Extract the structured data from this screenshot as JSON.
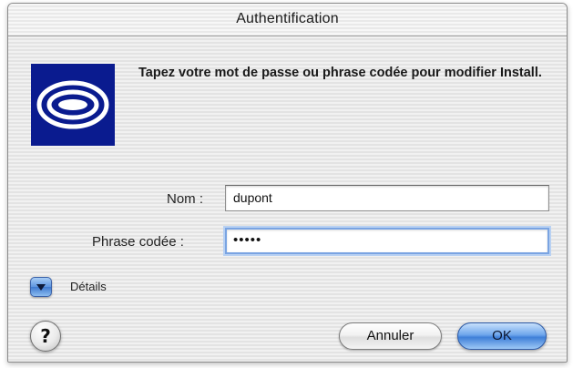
{
  "window": {
    "title": "Authentification"
  },
  "dialog": {
    "message": "Tapez votre mot de passe ou phrase codée pour modifier Install.",
    "app_icon": "install-app-logo"
  },
  "form": {
    "name_label": "Nom :",
    "name_value": "dupont",
    "passphrase_label": "Phrase codée :",
    "passphrase_value": "•••••"
  },
  "details": {
    "label": "Détails",
    "icon": "disclosure-triangle-down-icon"
  },
  "footer": {
    "help_label": "?",
    "cancel_label": "Annuler",
    "ok_label": "OK"
  },
  "colors": {
    "logo_background": "#0a1b8f",
    "default_button": "#3f7fd8",
    "focus_ring": "#7aa4e2"
  }
}
